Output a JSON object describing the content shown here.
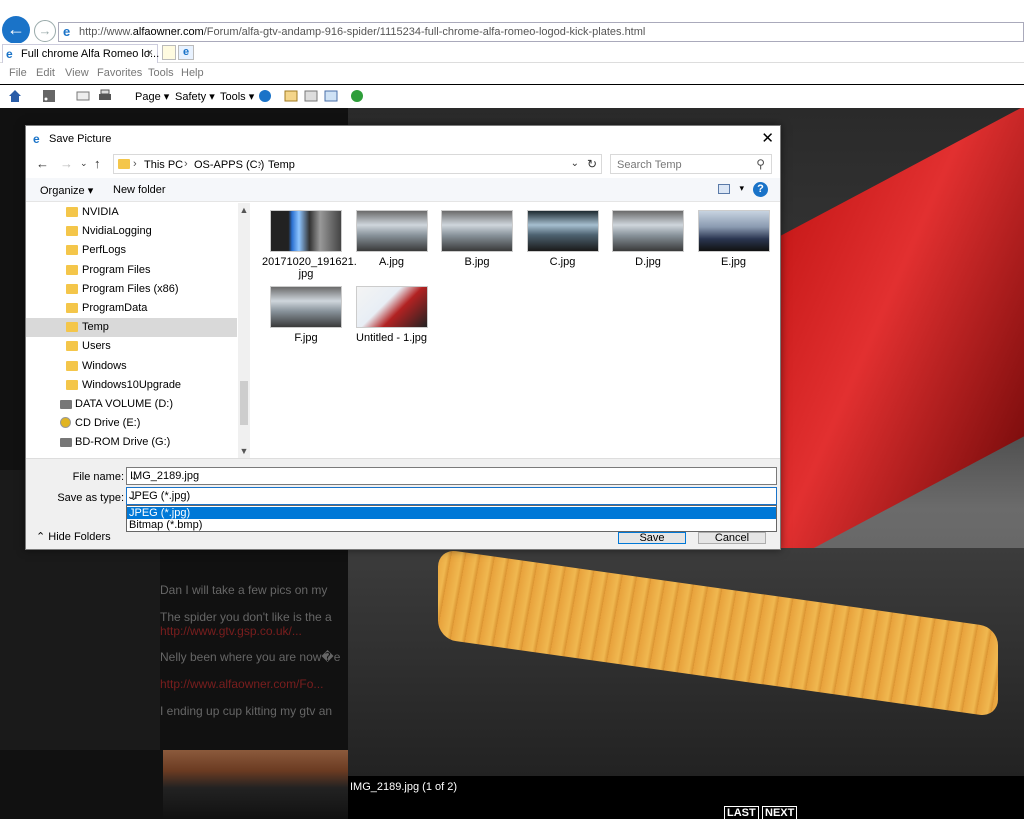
{
  "browser": {
    "url_prefix": "http://www.",
    "url_domain": "alfaowner.com",
    "url_path": "/Forum/alfa-gtv-andamp-916-spider/1115234-full-chrome-alfa-romeo-logod-kick-plates.html",
    "tab_title": "Full chrome Alfa Romeo lo...",
    "tab_close": "×",
    "menu": [
      "File",
      "Edit",
      "View",
      "Favorites",
      "Tools",
      "Help"
    ],
    "commands": {
      "page": "Page ▾",
      "safety": "Safety ▾",
      "tools": "Tools ▾"
    }
  },
  "page": {
    "lines": [
      "Dan I will take a few pics on my",
      "The spider you don't like is the a",
      "http://www.gtv.gsp.co.uk/...",
      "Nelly been where you are now�e",
      "http://www.alfaowner.com/Fo...",
      "I ending up cup kitting my gtv an"
    ],
    "caption": "IMG_2189.jpg (1 of 2)",
    "last": "LAST",
    "next": "NEXT"
  },
  "dialog": {
    "title": "Save Picture",
    "close": "✕",
    "breadcrumb": [
      "This PC",
      "OS-APPS (C:)",
      "Temp"
    ],
    "search_placeholder": "Search Temp",
    "toolbar": {
      "organize": "Organize ▾",
      "new_folder": "New folder",
      "help": "?"
    },
    "nav_items": [
      {
        "label": "NVIDIA",
        "type": "folder"
      },
      {
        "label": "NvidiaLogging",
        "type": "folder"
      },
      {
        "label": "PerfLogs",
        "type": "folder"
      },
      {
        "label": "Program Files",
        "type": "folder"
      },
      {
        "label": "Program Files (x86)",
        "type": "folder"
      },
      {
        "label": "ProgramData",
        "type": "folder"
      },
      {
        "label": "Temp",
        "type": "folder",
        "selected": true
      },
      {
        "label": "Users",
        "type": "folder"
      },
      {
        "label": "Windows",
        "type": "folder"
      },
      {
        "label": "Windows10Upgrade",
        "type": "folder"
      },
      {
        "label": "DATA VOLUME (D:)",
        "type": "drive"
      },
      {
        "label": "CD Drive (E:)",
        "type": "cd"
      },
      {
        "label": "BD-ROM Drive (G:)",
        "type": "drive"
      }
    ],
    "files": [
      {
        "name": "20171020_191621.\njpg",
        "thumb": "bottles"
      },
      {
        "name": "A.jpg",
        "thumb": "engine"
      },
      {
        "name": "B.jpg",
        "thumb": "engine"
      },
      {
        "name": "C.jpg",
        "thumb": "engine-dark"
      },
      {
        "name": "D.jpg",
        "thumb": "engine"
      },
      {
        "name": "E.jpg",
        "thumb": "car"
      },
      {
        "name": "F.jpg",
        "thumb": "engine"
      },
      {
        "name": "Untitled - 1.jpg",
        "thumb": "screenshot"
      }
    ],
    "file_name_label": "File name:",
    "file_name_value": "IMG_2189.jpg",
    "save_type_label": "Save as type:",
    "save_type_value": "JPEG (*.jpg)",
    "save_type_options": [
      "JPEG (*.jpg)",
      "Bitmap (*.bmp)"
    ],
    "hide_folders": "Hide Folders",
    "save_button": "Save",
    "cancel_button": "Cancel"
  },
  "colors": {
    "accent": "#0078d7",
    "folder": "#f4c64a",
    "ie_blue": "#1a73c8"
  }
}
